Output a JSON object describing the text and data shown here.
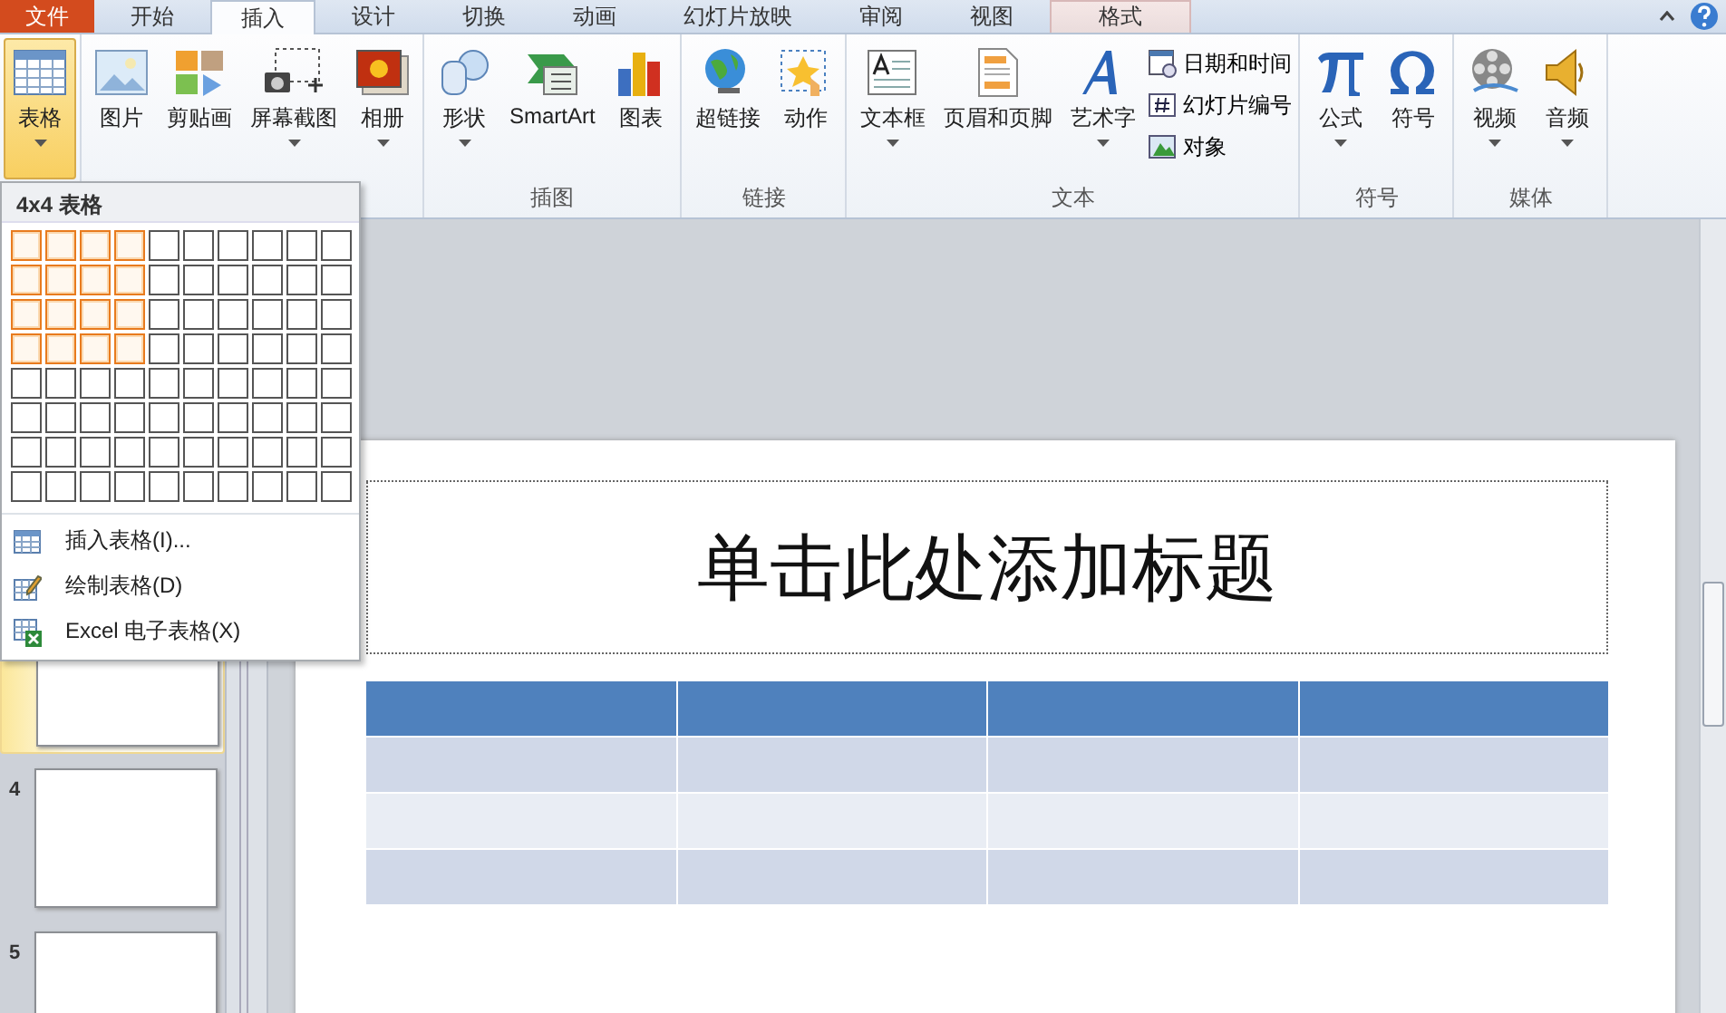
{
  "tabs": [
    {
      "label": "文件",
      "kind": "file",
      "selected": false
    },
    {
      "label": "开始",
      "kind": "normal",
      "selected": false
    },
    {
      "label": "插入",
      "kind": "normal",
      "selected": true
    },
    {
      "label": "设计",
      "kind": "normal",
      "selected": false
    },
    {
      "label": "切换",
      "kind": "normal",
      "selected": false
    },
    {
      "label": "动画",
      "kind": "normal",
      "selected": false
    },
    {
      "label": "幻灯片放映",
      "kind": "normal",
      "selected": false
    },
    {
      "label": "审阅",
      "kind": "normal",
      "selected": false
    },
    {
      "label": "视图",
      "kind": "normal",
      "selected": false
    },
    {
      "label": "格式",
      "kind": "contextual",
      "selected": false
    }
  ],
  "ribbon": {
    "groups": [
      {
        "buttons": [
          {
            "kind": "large",
            "label": "表格",
            "dropdown": true,
            "selected": true
          }
        ]
      },
      {
        "buttons": [
          {
            "kind": "large",
            "label": "图片",
            "dropdown": false,
            "selected": false
          },
          {
            "kind": "large",
            "label": "剪贴画",
            "dropdown": false,
            "selected": false
          },
          {
            "kind": "large",
            "label": "屏幕截图",
            "dropdown": true,
            "selected": false
          },
          {
            "kind": "large",
            "label": "相册",
            "dropdown": true,
            "selected": false
          }
        ]
      },
      {
        "label": "插图",
        "buttons": [
          {
            "kind": "large",
            "label": "形状",
            "dropdown": true,
            "selected": false
          },
          {
            "kind": "large",
            "label": "SmartArt",
            "dropdown": false,
            "selected": false
          },
          {
            "kind": "large",
            "label": "图表",
            "dropdown": false,
            "selected": false
          }
        ]
      },
      {
        "label": "链接",
        "buttons": [
          {
            "kind": "large",
            "label": "超链接",
            "dropdown": false,
            "selected": false
          },
          {
            "kind": "large",
            "label": "动作",
            "dropdown": false,
            "selected": false
          }
        ]
      },
      {
        "label": "文本",
        "buttons": [
          {
            "kind": "large",
            "label": "文本框",
            "dropdown": true,
            "selected": false
          },
          {
            "kind": "large",
            "label": "页眉和页脚",
            "dropdown": false,
            "selected": false
          },
          {
            "kind": "large",
            "label": "艺术字",
            "dropdown": true,
            "selected": false
          },
          {
            "kind": "small",
            "label": "日期和时间"
          },
          {
            "kind": "small",
            "label": "幻灯片编号"
          },
          {
            "kind": "small",
            "label": "对象"
          }
        ]
      },
      {
        "label": "符号",
        "buttons": [
          {
            "kind": "large",
            "label": "公式",
            "dropdown": true,
            "selected": false
          },
          {
            "kind": "large",
            "label": "符号",
            "dropdown": false,
            "selected": false
          }
        ]
      },
      {
        "label": "媒体",
        "buttons": [
          {
            "kind": "large",
            "label": "视频",
            "dropdown": true,
            "selected": false
          },
          {
            "kind": "large",
            "label": "音频",
            "dropdown": true,
            "selected": false
          }
        ]
      }
    ]
  },
  "table_menu": {
    "title": "4x4 表格",
    "grid": [
      [
        true,
        true,
        true,
        true,
        false,
        false,
        false,
        false,
        false,
        false
      ],
      [
        true,
        true,
        true,
        true,
        false,
        false,
        false,
        false,
        false,
        false
      ],
      [
        true,
        true,
        true,
        true,
        false,
        false,
        false,
        false,
        false,
        false
      ],
      [
        true,
        true,
        true,
        true,
        false,
        false,
        false,
        false,
        false,
        false
      ],
      [
        false,
        false,
        false,
        false,
        false,
        false,
        false,
        false,
        false,
        false
      ],
      [
        false,
        false,
        false,
        false,
        false,
        false,
        false,
        false,
        false,
        false
      ],
      [
        false,
        false,
        false,
        false,
        false,
        false,
        false,
        false,
        false,
        false
      ],
      [
        false,
        false,
        false,
        false,
        false,
        false,
        false,
        false,
        false,
        false
      ]
    ],
    "items": [
      {
        "label": "插入表格(I)..."
      },
      {
        "label": "绘制表格(D)"
      },
      {
        "label": "Excel 电子表格(X)"
      }
    ]
  },
  "slides": [
    {
      "selected": true
    },
    {
      "number": "4",
      "selected": false
    },
    {
      "number": "5",
      "selected": false
    }
  ],
  "slide": {
    "title_placeholder": "单击此处添加标题",
    "table": {
      "rows": [
        {
          "kind": "header"
        },
        {
          "kind": "band"
        },
        {
          "kind": "plain"
        },
        {
          "kind": "band"
        }
      ]
    }
  }
}
